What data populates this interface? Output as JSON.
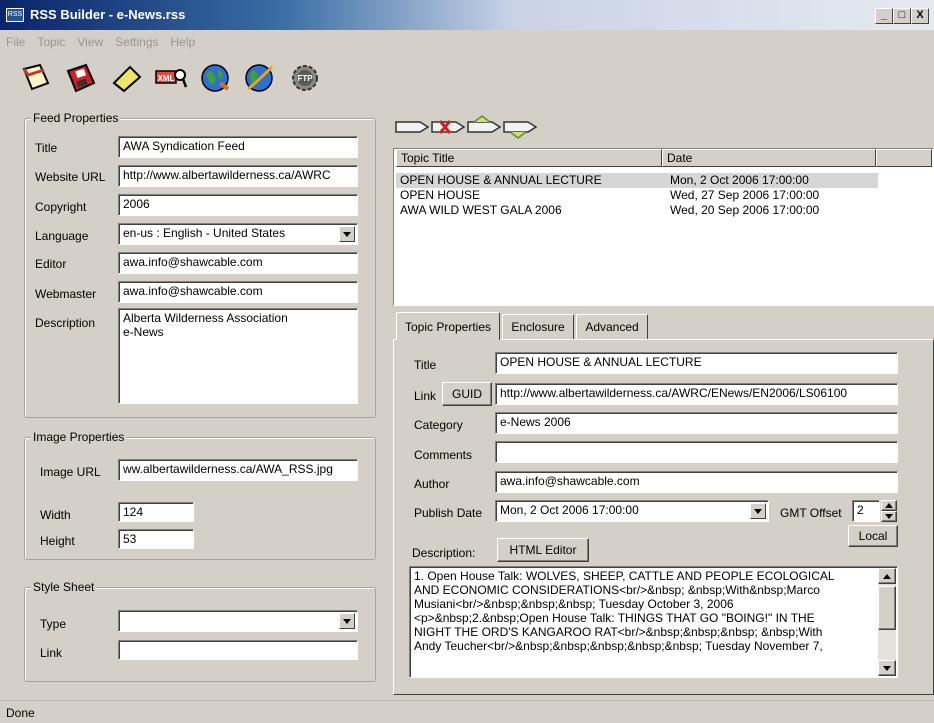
{
  "window": {
    "title": "RSS Builder - e-News.rss",
    "app_icon": "RSS",
    "minimize_label": "_",
    "maximize_label": "□",
    "close_label": "X"
  },
  "menu": [
    "File",
    "Topic",
    "View",
    "Settings",
    "Help"
  ],
  "toolbar": {
    "icons": [
      "new-document-icon",
      "save-disk-icon",
      "eraser-icon",
      "xml-view-icon",
      "globe-preview-icon",
      "globe-publish-icon",
      "ftp-gear-icon"
    ],
    "ftp_label": "FTP",
    "xml_label": "XML"
  },
  "feed": {
    "group_title": "Feed Properties",
    "title_label": "Title",
    "title_value": "AWA Syndication Feed",
    "website_label": "Website URL",
    "website_value": "http://www.albertawilderness.ca/AWRC",
    "copyright_label": "Copyright",
    "copyright_value": "2006",
    "language_label": "Language",
    "language_value": "en-us : English - United States",
    "editor_label": "Editor",
    "editor_value": "awa.info@shawcable.com",
    "webmaster_label": "Webmaster",
    "webmaster_value": "awa.info@shawcable.com",
    "description_label": "Description",
    "description_line1": "Alberta Wilderness Association",
    "description_line2": "e-News"
  },
  "image": {
    "group_title": "Image Properties",
    "url_label": "Image URL",
    "url_value": "ww.albertawilderness.ca/AWA_RSS.jpg",
    "width_label": "Width",
    "width_value": "124",
    "height_label": "Height",
    "height_value": "53"
  },
  "stylesheet": {
    "group_title": "Style Sheet",
    "type_label": "Type",
    "type_value": "",
    "link_label": "Link",
    "link_value": ""
  },
  "topic_list": {
    "headers": [
      "Topic Title",
      "Date"
    ],
    "rows": [
      {
        "title": "OPEN HOUSE & ANNUAL LECTURE",
        "date": "Mon, 2 Oct 2006 17:00:00"
      },
      {
        "title": "OPEN HOUSE",
        "date": "Wed, 27 Sep 2006 17:00:00"
      },
      {
        "title": "AWA WILD WEST GALA 2006",
        "date": "Wed, 20 Sep 2006 17:00:00"
      }
    ]
  },
  "tabs": [
    "Topic Properties",
    "Enclosure",
    "Advanced"
  ],
  "topic": {
    "title_label": "Title",
    "title_value": "OPEN HOUSE & ANNUAL LECTURE",
    "link_label": "Link",
    "guid_button": "GUID",
    "link_value": "http://www.albertawilderness.ca/AWRC/ENews/EN2006/LS06100",
    "category_label": "Category",
    "category_value": "e-News 2006",
    "comments_label": "Comments",
    "comments_value": "",
    "author_label": "Author",
    "author_value": "awa.info@shawcable.com",
    "publish_label": "Publish Date",
    "publish_value": "Mon,  2 Oct 2006 17:00:00",
    "gmt_label": "GMT Offset",
    "gmt_value": "2",
    "local_button": "Local",
    "description_label": "Description:",
    "html_editor_button": "HTML Editor",
    "description_lines": [
      "1. Open House Talk: WOLVES, SHEEP, CATTLE AND PEOPLE ECOLOGICAL",
      "AND ECONOMIC CONSIDERATIONS<br/>&nbsp; &nbsp;With&nbsp;Marco",
      "Musiani<br/>&nbsp;&nbsp;&nbsp; Tuesday October 3, 2006",
      "<p>&nbsp;2.&nbsp;Open House Talk: THINGS THAT GO \"BOING!\" IN THE",
      "NIGHT THE ORD'S KANGAROO RAT<br/>&nbsp;&nbsp;&nbsp; &nbsp;With",
      "Andy Teucher<br/>&nbsp;&nbsp;&nbsp;&nbsp;&nbsp; Tuesday November 7,"
    ]
  },
  "status": "Done"
}
